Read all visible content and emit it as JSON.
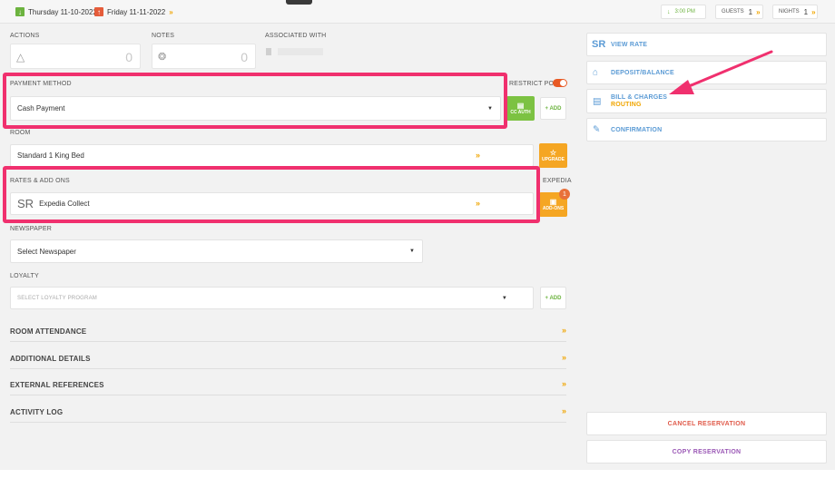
{
  "header": {
    "arrival_date": "Thursday 11-10-2022",
    "departure_date": "Friday 11-11-2022",
    "time": "3:00 PM",
    "guests_label": "GUESTS",
    "guests_value": "1",
    "nights_label": "NIGHTS",
    "nights_value": "1"
  },
  "actions": {
    "label": "ACTIONS",
    "count": "0"
  },
  "notes": {
    "label": "NOTES",
    "count": "0"
  },
  "associated": {
    "label": "ASSOCIATED WITH"
  },
  "payment": {
    "label": "PAYMENT METHOD",
    "value": "Cash Payment",
    "restrict_post_label": "RESTRICT POST",
    "cc_auth_label": "CC AUTH",
    "add_label": "+ ADD"
  },
  "room": {
    "label": "ROOM",
    "value": "Standard 1 King Bed",
    "upgrade_label": "UPGRADE"
  },
  "rates": {
    "label": "RATES & ADD ONS",
    "code": "SR",
    "value": "Expedia Collect",
    "source_label": "EXPEDIA",
    "addons_label": "ADD-ONS",
    "addons_badge": "1"
  },
  "newspaper": {
    "label": "NEWSPAPER",
    "value": "Select Newspaper"
  },
  "loyalty": {
    "label": "LOYALTY",
    "placeholder": "SELECT LOYALTY PROGRAM",
    "add_label": "+ ADD"
  },
  "sections": [
    "ROOM ATTENDANCE",
    "ADDITIONAL DETAILS",
    "EXTERNAL REFERENCES",
    "ACTIVITY LOG"
  ],
  "sidebar": {
    "view_rate_code": "SR",
    "view_rate": "VIEW RATE",
    "deposit_balance": "DEPOSIT/BALANCE",
    "bill_charges_line1": "BILL & CHARGES",
    "bill_charges_line2": "ROUTING",
    "confirmation": "CONFIRMATION",
    "cancel_reservation": "CANCEL RESERVATION",
    "copy_reservation": "COPY RESERVATION"
  },
  "colors": {
    "highlight": "#f0306e",
    "accent_blue": "#5b9bd5",
    "accent_orange": "#f0a500",
    "accent_green": "#6cb33f",
    "cancel": "#e05a4a",
    "copy": "#9b59b6"
  }
}
